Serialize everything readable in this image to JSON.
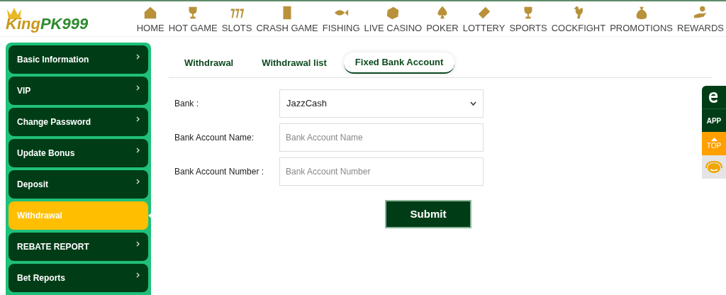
{
  "logo": {
    "part_1": "King",
    "part_2": "PK999"
  },
  "nav": [
    {
      "label": "HOME"
    },
    {
      "label": "HOT GAME"
    },
    {
      "label": "SLOTS"
    },
    {
      "label": "CRASH GAME"
    },
    {
      "label": "FISHING"
    },
    {
      "label": "LIVE CASINO"
    },
    {
      "label": "POKER"
    },
    {
      "label": "LOTTERY"
    },
    {
      "label": "SPORTS"
    },
    {
      "label": "COCKFIGHT"
    },
    {
      "label": "PROMOTIONS"
    },
    {
      "label": "REWARDS"
    }
  ],
  "sidebar": {
    "items": [
      {
        "label": "Basic Information",
        "selected": false
      },
      {
        "label": "VIP",
        "selected": false
      },
      {
        "label": "Change Password",
        "selected": false
      },
      {
        "label": "Update Bonus",
        "selected": false
      },
      {
        "label": "Deposit",
        "selected": false
      },
      {
        "label": "Withdrawal",
        "selected": true
      },
      {
        "label": "REBATE REPORT",
        "selected": false
      },
      {
        "label": "Bet Reports",
        "selected": false
      }
    ]
  },
  "tabs": [
    {
      "label": "Withdrawal",
      "selected": false
    },
    {
      "label": "Withdrawal list",
      "selected": false
    },
    {
      "label": "Fixed Bank Account",
      "selected": true
    }
  ],
  "form": {
    "fields": [
      {
        "kind": "select",
        "label": "Bank :",
        "value": "JazzCash"
      },
      {
        "kind": "input",
        "label": "Bank Account Name:",
        "placeholder": "Bank Account Name"
      },
      {
        "kind": "input",
        "label": "Bank Account Number :",
        "placeholder": "Bank Account Number"
      }
    ],
    "submit": "Submit"
  },
  "float_bar": {
    "app": "APP",
    "top": "TOP"
  }
}
